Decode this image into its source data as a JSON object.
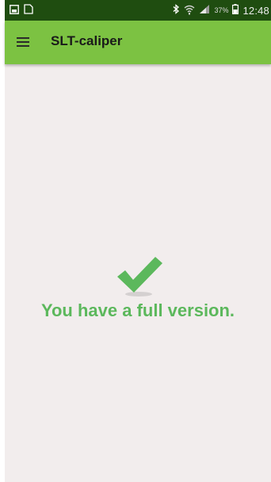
{
  "status_bar": {
    "time": "12:48",
    "battery_percent": "37%",
    "icons": [
      "image-notification-icon",
      "screenshot-notification-icon",
      "bluetooth-icon",
      "wifi-icon",
      "signal-icon",
      "battery-icon"
    ]
  },
  "app_bar": {
    "title": "SLT-caliper",
    "menu_icon": "hamburger-menu-icon",
    "color": "#7cc242"
  },
  "main": {
    "message": "You have a full version.",
    "check_icon": "checkmark-icon",
    "message_color": "#5cb85c",
    "background": "#f2eded"
  }
}
